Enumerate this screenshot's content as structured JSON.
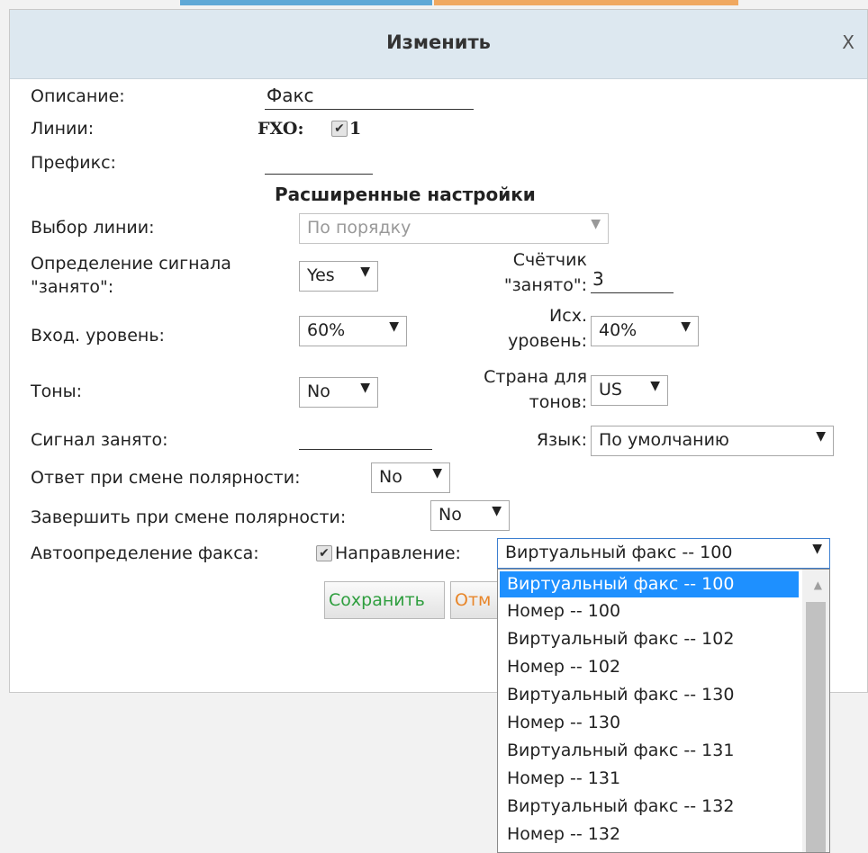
{
  "dialog": {
    "title": "Изменить",
    "close": "X"
  },
  "form": {
    "description_label": "Описание:",
    "description_value": "Факс",
    "lines_label": "Линии:",
    "lines_type": "FXO:",
    "lines_checked": true,
    "lines_number": "1",
    "prefix_label": "Префикс:",
    "prefix_value": "",
    "advanced_title": "Расширенные настройки",
    "line_choice_label": "Выбор линии:",
    "line_choice_value": "По порядку",
    "busy_detect_label_1": "Определение сигнала",
    "busy_detect_label_2": "\"занято\":",
    "busy_detect_value": "Yes",
    "busy_count_label_1": "Счётчик",
    "busy_count_label_2": "\"занято\":",
    "busy_count_value": "3",
    "in_level_label": "Вход. уровень:",
    "in_level_value": "60%",
    "out_level_label_1": "Исх.",
    "out_level_label_2": "уровень:",
    "out_level_value": "40%",
    "tones_label": "Тоны:",
    "tones_value": "No",
    "tone_country_label_1": "Страна для",
    "tone_country_label_2": "тонов:",
    "tone_country_value": "US",
    "busy_signal_label": "Сигнал занято:",
    "busy_signal_value": "",
    "language_label": "Язык:",
    "language_value": "По умолчанию",
    "answer_polarity_label": "Ответ при смене полярности:",
    "answer_polarity_value": "No",
    "end_polarity_label": "Завершить при смене полярности:",
    "end_polarity_value": "No",
    "fax_detect_label": "Автоопределение факса:",
    "fax_detect_checked": true,
    "direction_label": "Направление:",
    "direction_value": "Виртуальный факс -- 100"
  },
  "buttons": {
    "save": "Сохранить",
    "cancel_partial": "Отм"
  },
  "direction_options": [
    "Виртуальный факс -- 100",
    "Номер -- 100",
    "Виртуальный факс -- 102",
    "Номер -- 102",
    "Виртуальный факс -- 130",
    "Номер -- 130",
    "Виртуальный факс -- 131",
    "Номер -- 131",
    "Виртуальный факс -- 132",
    "Номер -- 132"
  ],
  "colors": {
    "header_bg": "#dde8f0",
    "save_text": "#2e9e3e",
    "cancel_text": "#e8862a",
    "selection": "#1e90ff"
  }
}
